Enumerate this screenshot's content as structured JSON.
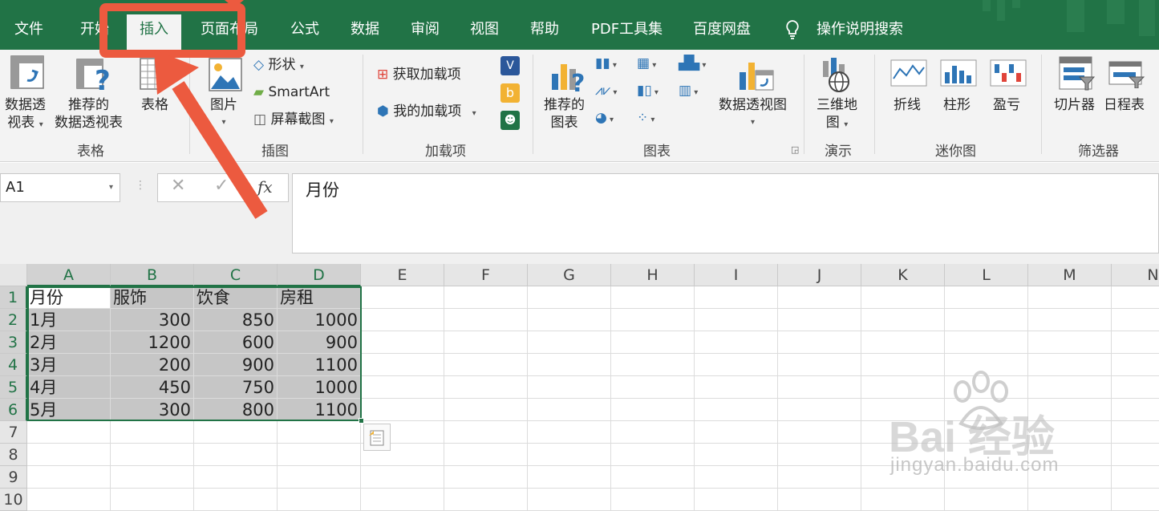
{
  "tabs": [
    {
      "label": "文件",
      "active": false
    },
    {
      "label": "开始",
      "active": false
    },
    {
      "label": "插入",
      "active": true
    },
    {
      "label": "页面布局",
      "active": false
    },
    {
      "label": "公式",
      "active": false
    },
    {
      "label": "数据",
      "active": false
    },
    {
      "label": "审阅",
      "active": false
    },
    {
      "label": "视图",
      "active": false
    },
    {
      "label": "帮助",
      "active": false
    },
    {
      "label": "PDF工具集",
      "active": false
    },
    {
      "label": "百度网盘",
      "active": false
    }
  ],
  "search_label": "操作说明搜索",
  "ribbon": {
    "tables": {
      "pivot_line1": "数据透",
      "pivot_line2": "视表",
      "recommended_line1": "推荐的",
      "recommended_line2": "数据透视表",
      "table": "表格",
      "group": "表格"
    },
    "illustrations": {
      "pictures": "图片",
      "shapes": "形状",
      "smartart": "SmartArt",
      "screenshot": "屏幕截图",
      "group": "插图"
    },
    "addins": {
      "get": "获取加载项",
      "my": "我的加载项",
      "group": "加载项"
    },
    "charts": {
      "recommended_line1": "推荐的",
      "recommended_line2": "图表",
      "pivotchart": "数据透视图",
      "group": "图表"
    },
    "tours": {
      "map_line1": "三维地",
      "map_line2": "图",
      "group": "演示"
    },
    "sparklines": {
      "line": "折线",
      "column": "柱形",
      "winloss": "盈亏",
      "group": "迷你图"
    },
    "filters": {
      "slicer": "切片器",
      "timeline": "日程表",
      "group": "筛选器"
    }
  },
  "namebox": "A1",
  "fx": "fx",
  "formula": "月份",
  "columns": [
    "A",
    "B",
    "C",
    "D",
    "E",
    "F",
    "G",
    "H",
    "I",
    "J",
    "K",
    "L",
    "M",
    "N"
  ],
  "rows": [
    "1",
    "2",
    "3",
    "4",
    "5",
    "6",
    "7",
    "8",
    "9",
    "10"
  ],
  "table": [
    [
      "月份",
      "服饰",
      "饮食",
      "房租"
    ],
    [
      "1月",
      "300",
      "850",
      "1000"
    ],
    [
      "2月",
      "1200",
      "600",
      "900"
    ],
    [
      "3月",
      "200",
      "900",
      "1100"
    ],
    [
      "4月",
      "450",
      "750",
      "1000"
    ],
    [
      "5月",
      "300",
      "800",
      "1100"
    ]
  ],
  "watermark_brand": "Bai 经验",
  "watermark_url": "jingyan.baidu.com",
  "colors": {
    "excel_green": "#217346",
    "annotation_red": "#ec5a3f",
    "selection_shade": "#c6c6c6"
  }
}
